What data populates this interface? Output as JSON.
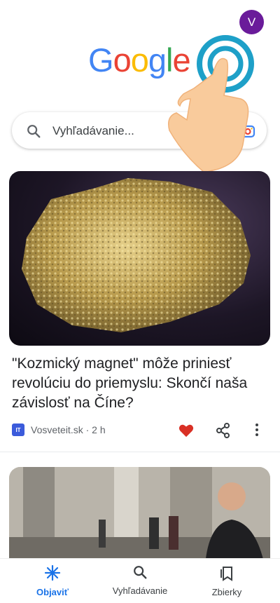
{
  "header": {
    "avatar_initial": "V",
    "logo_letters": [
      "G",
      "o",
      "o",
      "g",
      "l",
      "e"
    ]
  },
  "search": {
    "placeholder": "Vyhľadávanie...",
    "search_icon": "search-icon",
    "lens_icon": "google-lens-icon"
  },
  "feed": {
    "cards": [
      {
        "headline": "\"Kozmický magnet\" môže priniesť revolúciu do priemyslu: Skončí naša závislosť na Číne?",
        "source_badge": "IT",
        "source": "Vosveteit.sk · 2 h",
        "liked": true
      }
    ]
  },
  "bottom_nav": {
    "items": [
      {
        "label": "Objaviť",
        "icon": "discover-asterisk-icon",
        "active": true
      },
      {
        "label": "Vyhľadávanie",
        "icon": "search-icon",
        "active": false
      },
      {
        "label": "Zbierky",
        "icon": "collections-icon",
        "active": false
      }
    ]
  },
  "colors": {
    "accent": "#1a73e8",
    "avatar_bg": "#6a1b9a",
    "heart": "#d93025"
  }
}
